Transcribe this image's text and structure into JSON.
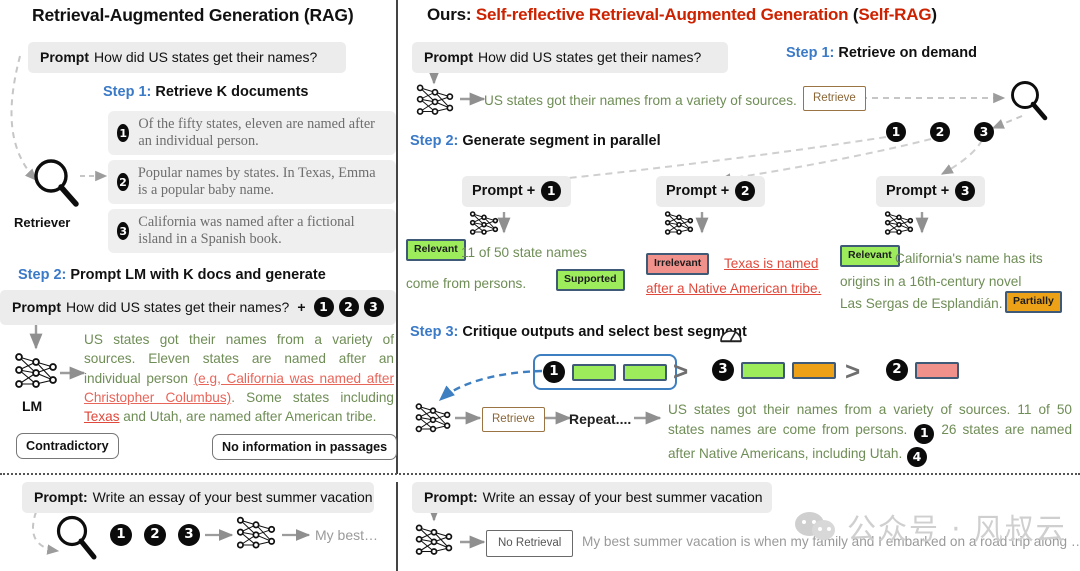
{
  "left_panel": {
    "title": "Retrieval-Augmented Generation (RAG)",
    "prompt_label": "Prompt",
    "prompt_text": "How did US states get their names?",
    "step1": {
      "num": "Step 1:",
      "text": " Retrieve K documents"
    },
    "retriever_label": "Retriever",
    "documents": [
      {
        "id": "1",
        "text": "Of the fifty states, eleven are named after an individual person."
      },
      {
        "id": "2",
        "text": "Popular names by states. In Texas, Emma is a popular baby name."
      },
      {
        "id": "3",
        "text": "California was named after a fictional island in a Spanish book."
      }
    ],
    "step2": {
      "num": "Step 2:",
      "text": " Prompt LM with K docs and generate"
    },
    "prompt_plus_label": "Prompt",
    "prompt_plus_text": "How did US states get their names?",
    "plus_sign": "+",
    "plus_badges": [
      "1",
      "2",
      "3"
    ],
    "lm_label": "LM",
    "generation": {
      "seg1": "US states got their names from a variety of sources. Eleven states are named after an individual person ",
      "seg2_wrong": "(e.g, California was named after Christopher Columbus)",
      "seg3": ". Some states including ",
      "seg4_wrong": "Texas",
      "seg5": " and Utah, are named after ",
      "seg6": "American tribe."
    },
    "callouts": {
      "contradictory": "Contradictory",
      "no_info": "No information in passages"
    },
    "bottom": {
      "prompt_label": "Prompt:",
      "prompt_text": "Write an essay of your best summer vacation",
      "badges": [
        "1",
        "2",
        "3"
      ],
      "output": "My best…"
    }
  },
  "right_panel": {
    "title_prefix": "Ours: ",
    "title_main": "Self-reflective Retrieval-Augmented Generation",
    "title_paren_open": " (",
    "title_abbr": "Self-RAG",
    "title_paren_close": ")",
    "prompt_label": "Prompt",
    "prompt_text": "How did US states get their names?",
    "step1": {
      "num": "Step 1:",
      "text": " Retrieve on demand"
    },
    "step1_generation": "US states got their names from a variety of sources.",
    "retrieve_token": "Retrieve",
    "doc_badges": [
      "1",
      "2",
      "3"
    ],
    "step2": {
      "num": "Step 2:",
      "text": " Generate segment in parallel"
    },
    "columns": [
      {
        "header_label": "Prompt +",
        "header_badge": "1",
        "chips": [
          {
            "label": "Relevant",
            "kind": "relevant"
          },
          {
            "label": "Supported",
            "kind": "supported"
          }
        ],
        "text_a": "11 of 50 state names",
        "text_b": "come from persons."
      },
      {
        "header_label": "Prompt +",
        "header_badge": "2",
        "chips": [
          {
            "label": "Irrelevant",
            "kind": "irrelevant"
          }
        ],
        "text_a": "Texas is named",
        "text_b": "after a Native American tribe."
      },
      {
        "header_label": "Prompt +",
        "header_badge": "3",
        "chips": [
          {
            "label": "Relevant",
            "kind": "relevant"
          },
          {
            "label": "Partially",
            "kind": "partially"
          }
        ],
        "text_a": "California's name has its",
        "text_b": "origins in a 16th-century novel",
        "text_c": "Las Sergas de Esplandián."
      }
    ],
    "step3": {
      "num": "Step 3:",
      "text": " Critique outputs and select best segment"
    },
    "ranking": [
      {
        "badge": "1",
        "boxes": [
          "green",
          "green"
        ],
        "selected": true
      },
      {
        "badge": "3",
        "boxes": [
          "green",
          "orange"
        ],
        "selected": false
      },
      {
        "badge": "2",
        "boxes": [
          "red"
        ],
        "selected": false
      }
    ],
    "gt_symbol": ">",
    "retrieve_token2": "Retrieve",
    "repeat_text": "Repeat....",
    "final_output": {
      "part1": "US states got their names from a variety of sources. 11 of 50 states names are come from persons.",
      "badge1": "1",
      "part2": "26 states are named after Native Americans, including Utah.",
      "badge2": "4"
    },
    "bottom": {
      "prompt_label": "Prompt:",
      "prompt_text": "Write an essay of your best summer vacation",
      "no_retrieval_token": "No Retrieval",
      "output": "My best summer vacation is when my family and I embarked on a road trip along …"
    }
  },
  "watermark": {
    "text": "公众号 · 风叔云"
  },
  "colors": {
    "step_blue": "#3b7ac7",
    "title_red": "#cc2200",
    "generated_green": "#6f8d56",
    "error_red": "#e0483b",
    "chip_green": "#9cec5c",
    "chip_orange": "#eda117",
    "chip_red": "#f0918c",
    "chip_border": "#3e5a76",
    "retrieve_brown": "#8a6636"
  }
}
